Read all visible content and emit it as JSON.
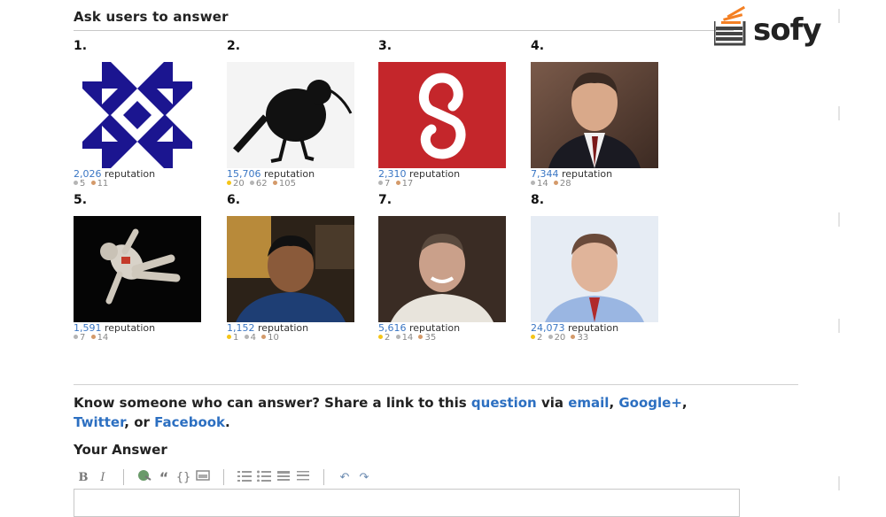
{
  "section": {
    "title": "Ask users to answer"
  },
  "logo": {
    "text": "sofy"
  },
  "users": [
    {
      "rank": "1.",
      "avatar": "identicon-blue-avatar",
      "reputation": "2,026",
      "rep_label": "reputation",
      "badges": {
        "silver": "5",
        "bronze": "11"
      }
    },
    {
      "rank": "2.",
      "avatar": "kiwi-bird-avatar",
      "reputation": "15,706",
      "rep_label": "reputation",
      "badges": {
        "gold": "20",
        "silver": "62",
        "bronze": "105"
      }
    },
    {
      "rank": "3.",
      "avatar": "red-logo-avatar",
      "reputation": "2,310",
      "rep_label": "reputation",
      "badges": {
        "silver": "7",
        "bronze": "17"
      }
    },
    {
      "rank": "4.",
      "avatar": "suit-portrait-avatar",
      "reputation": "7,344",
      "rep_label": "reputation",
      "badges": {
        "silver": "14",
        "bronze": "28"
      }
    },
    {
      "rank": "5.",
      "avatar": "astronaut-avatar",
      "reputation": "1,591",
      "rep_label": "reputation",
      "badges": {
        "silver": "7",
        "bronze": "14"
      }
    },
    {
      "rank": "6.",
      "avatar": "webcam-portrait-avatar",
      "reputation": "1,152",
      "rep_label": "reputation",
      "badges": {
        "gold": "1",
        "silver": "4",
        "bronze": "10"
      }
    },
    {
      "rank": "7.",
      "avatar": "smiling-man-avatar",
      "reputation": "5,616",
      "rep_label": "reputation",
      "badges": {
        "gold": "2",
        "silver": "14",
        "bronze": "35"
      }
    },
    {
      "rank": "8.",
      "avatar": "man-portrait-avatar",
      "reputation": "24,073",
      "rep_label": "reputation",
      "badges": {
        "gold": "2",
        "silver": "20",
        "bronze": "33"
      }
    }
  ],
  "share": {
    "prefix": "Know someone who can answer? Share a link to this ",
    "question_link": "question",
    "via": " via ",
    "email_link": "email",
    "comma1": ", ",
    "gplus_link": "Google+",
    "comma2": ",",
    "twitter_link": "Twitter",
    "or": ", or ",
    "facebook_link": "Facebook",
    "end": "."
  },
  "answer": {
    "title": "Your Answer",
    "toolbar": {
      "bold": "B",
      "italic": "I",
      "quote": "“",
      "code": "{}",
      "undo": "↶",
      "redo": "↷"
    }
  },
  "colors": {
    "link": "#2c6fc1",
    "rep_value": "#3a76c4",
    "gold": "#f5c518",
    "silver": "#b5b5b5",
    "bronze": "#d49a6a"
  }
}
